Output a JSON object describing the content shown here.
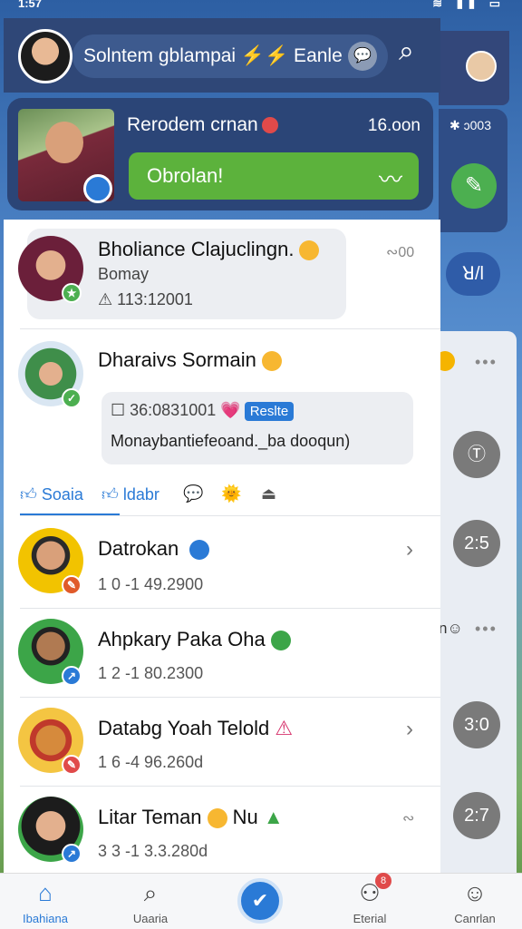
{
  "status": {
    "time": "1:57",
    "icons": "▣ ▣"
  },
  "header": {
    "title": "Solntem gblampai ⚡⚡ Eanle",
    "chat_icon": "chat-bubble-icon",
    "search_icon": "search-icon"
  },
  "featured": {
    "name": "Rerodem crnan",
    "time": "16.oon",
    "button_label": "Obrolan!",
    "trend_icon": "trend-icon"
  },
  "behind": {
    "count": "✱ ɔ003",
    "pill": "ꓤ/l",
    "circle1": "Ⓣ",
    "circle2": "2:5",
    "circle3": "3:0",
    "circle4": "2:7",
    "text_mid": "n☺",
    "tab_label": "Canrlan"
  },
  "chats": [
    {
      "name": "Bholiance Clajuclingn.",
      "snippet": "Bomay",
      "meta": "⚠ 113:12001",
      "status": "∾00"
    },
    {
      "name": "Dharaivs Sormain",
      "meta_prefix": "☐ 36:0831001",
      "tag": "Reslte",
      "message": "Monaybantiefeoand._ba dooqun)"
    },
    {
      "name": "Datrokan",
      "meta": "1 0 -1 49.2900"
    },
    {
      "name": "Ahpkary Paka",
      "name_suffix": "Oha",
      "meta": "1 2 -1 80.2300"
    },
    {
      "name": "Databg Yoah Telold",
      "meta": "1 6 -4 96.260d"
    },
    {
      "name": "Litar Teman",
      "name_suffix": "Nu",
      "meta": "3 3 -1 3.3.280d"
    }
  ],
  "actions": {
    "item1": "Soaia",
    "item2": "ldabr"
  },
  "tabs": [
    {
      "label": "Ibahiana"
    },
    {
      "label": "Uaaria"
    },
    {
      "label": "Eterial"
    },
    {
      "label": "Canrlan"
    }
  ],
  "notification_count": "8"
}
